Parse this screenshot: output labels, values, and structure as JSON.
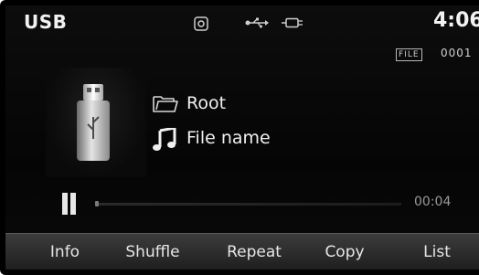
{
  "status_bar": {
    "source": "USB",
    "time": "4:06",
    "file_badge": "FILE",
    "file_number": "0001"
  },
  "track": {
    "folder": "Root",
    "file_name": "File name",
    "elapsed": "00:04",
    "progress": 0.0
  },
  "menu": {
    "info": "Info",
    "shuffle": "Shuffle",
    "repeat": "Repeat",
    "copy": "Copy",
    "list": "List"
  },
  "icons": {
    "disc": "disc-icon",
    "usb": "usb-icon",
    "plug": "plug-icon",
    "folder": "folder-icon",
    "music_note": "music-note-icon",
    "usb_stick": "usb-stick-icon",
    "pause": "pause-icon"
  }
}
